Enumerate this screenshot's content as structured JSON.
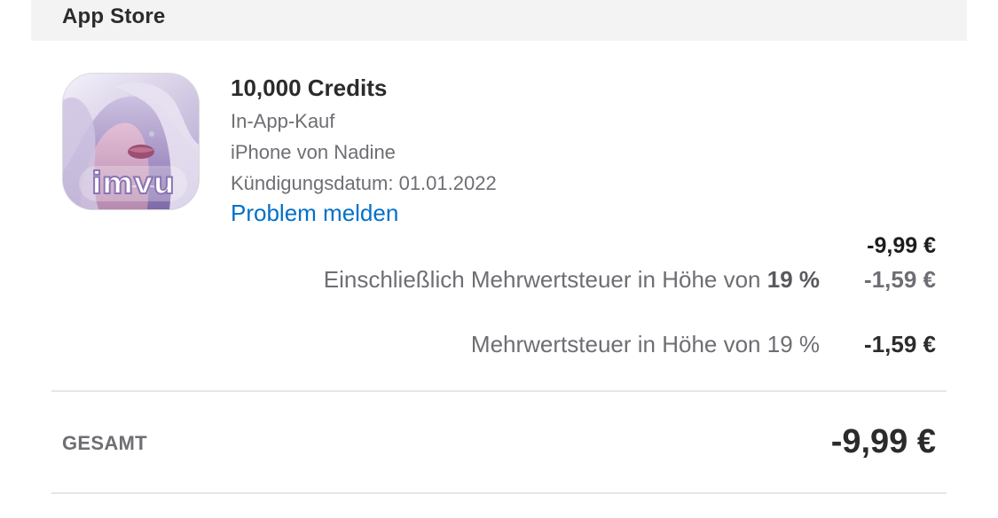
{
  "header": {
    "title": "App Store"
  },
  "purchase": {
    "app_icon": "imvu-app-icon",
    "app_icon_text": "imvu",
    "title": "10,000 Credits",
    "type": "In-App-Kauf",
    "device": "iPhone von Nadine",
    "cancellation_date": "Kündigungsdatum: 01.01.2022",
    "report_problem_label": "Problem melden",
    "price": "-9,99 €"
  },
  "tax": {
    "included_label_prefix": "Einschließlich Mehrwertsteuer in Höhe von ",
    "included_rate": "19 %",
    "included_value": "-1,59 €",
    "vat_label": "Mehrwertsteuer in Höhe von 19 %",
    "vat_value": "-1,59 €"
  },
  "total": {
    "label": "GESAMT",
    "value": "-9,99 €"
  },
  "colors": {
    "link": "#0070c9",
    "header_bg": "#f3f3f3",
    "secondary_text": "#6e6e73",
    "divider": "#e6e6e6"
  }
}
